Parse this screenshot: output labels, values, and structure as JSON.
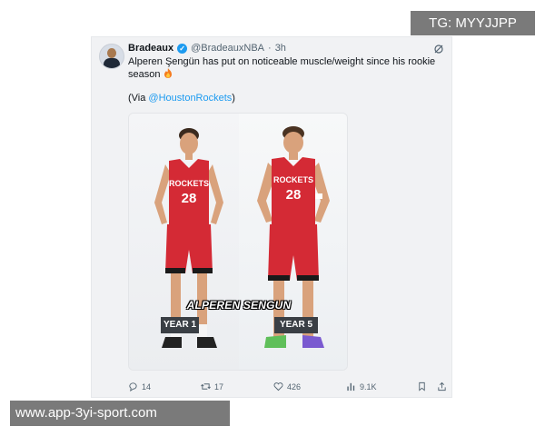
{
  "tweet": {
    "author_name": "Bradeaux",
    "handle": "@BradeauxNBA",
    "separator": "·",
    "time": "3h",
    "text": "Alperen Şengün has put on noticeable muscle/weight since his rookie season",
    "via_prefix": "(Via ",
    "via_mention": "@HoustonRockets",
    "via_suffix": ")"
  },
  "media": {
    "overlay_name": "ALPEREN SENGUN",
    "left_label": "YEAR 1",
    "right_label": "YEAR 5",
    "jersey_text": "ROCKETS",
    "jersey_number": "28"
  },
  "actions": {
    "replies": "14",
    "retweets": "17",
    "likes": "426",
    "views": "9.1K"
  },
  "watermarks": {
    "top": "TG: MYYJJPP",
    "bottom": "www.app-3yi-sport.com"
  },
  "colors": {
    "link": "#1d9bf0",
    "jersey_red": "#d42a35",
    "jersey_dark": "#1a1a1a"
  },
  "icons": [
    "verified-badge-icon",
    "grok-menu-icon",
    "fire-icon",
    "reply-icon",
    "retweet-icon",
    "like-icon",
    "views-icon",
    "bookmark-icon",
    "share-icon"
  ]
}
